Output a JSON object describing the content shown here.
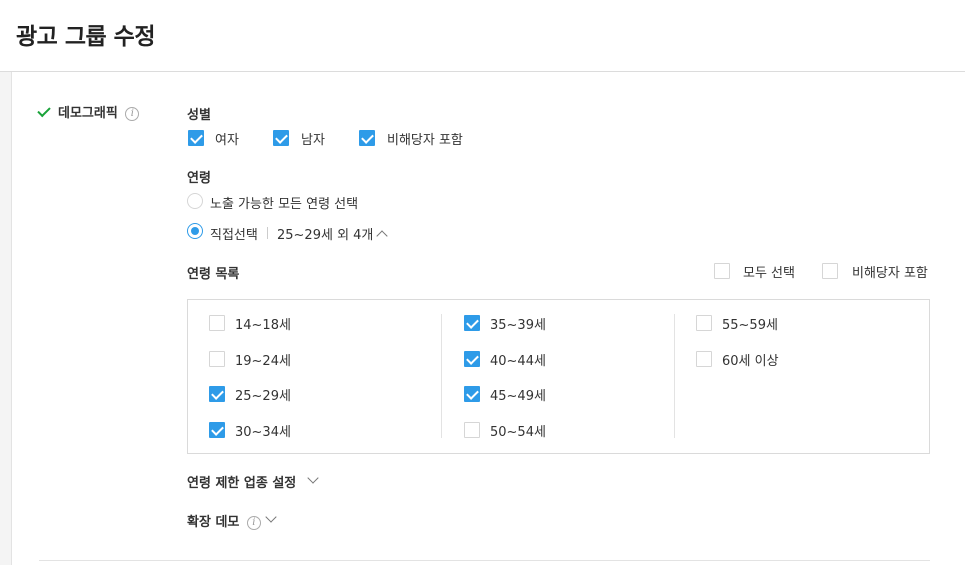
{
  "page": {
    "title": "광고 그룹 수정"
  },
  "section": {
    "label": "데모그래픽",
    "info_glyph": "i"
  },
  "gender": {
    "title": "성별",
    "options": [
      {
        "label": "여자",
        "checked": true
      },
      {
        "label": "남자",
        "checked": true
      },
      {
        "label": "비해당자 포함",
        "checked": true
      }
    ]
  },
  "age": {
    "title": "연령",
    "radio_all_label": "노출 가능한 모든 연령 선택",
    "radio_direct_label": "직접선택",
    "selected_summary": "25~29세 외 4개",
    "selected_mode": "direct",
    "list_title": "연령 목록",
    "select_all_label": "모두 선택",
    "include_unknown_label": "비해당자 포함",
    "columns": [
      [
        {
          "label": "14~18세",
          "checked": false
        },
        {
          "label": "19~24세",
          "checked": false
        },
        {
          "label": "25~29세",
          "checked": true
        },
        {
          "label": "30~34세",
          "checked": true
        }
      ],
      [
        {
          "label": "35~39세",
          "checked": true
        },
        {
          "label": "40~44세",
          "checked": true
        },
        {
          "label": "45~49세",
          "checked": true
        },
        {
          "label": "50~54세",
          "checked": false
        }
      ],
      [
        {
          "label": "55~59세",
          "checked": false
        },
        {
          "label": "60세 이상",
          "checked": false
        }
      ]
    ]
  },
  "restricted_industry": {
    "label": "연령 제한 업종 설정"
  },
  "extended_demo": {
    "label": "확장 데모",
    "info_glyph": "i"
  },
  "colors": {
    "accent": "#2e9be8",
    "check_green": "#1aa33a"
  }
}
